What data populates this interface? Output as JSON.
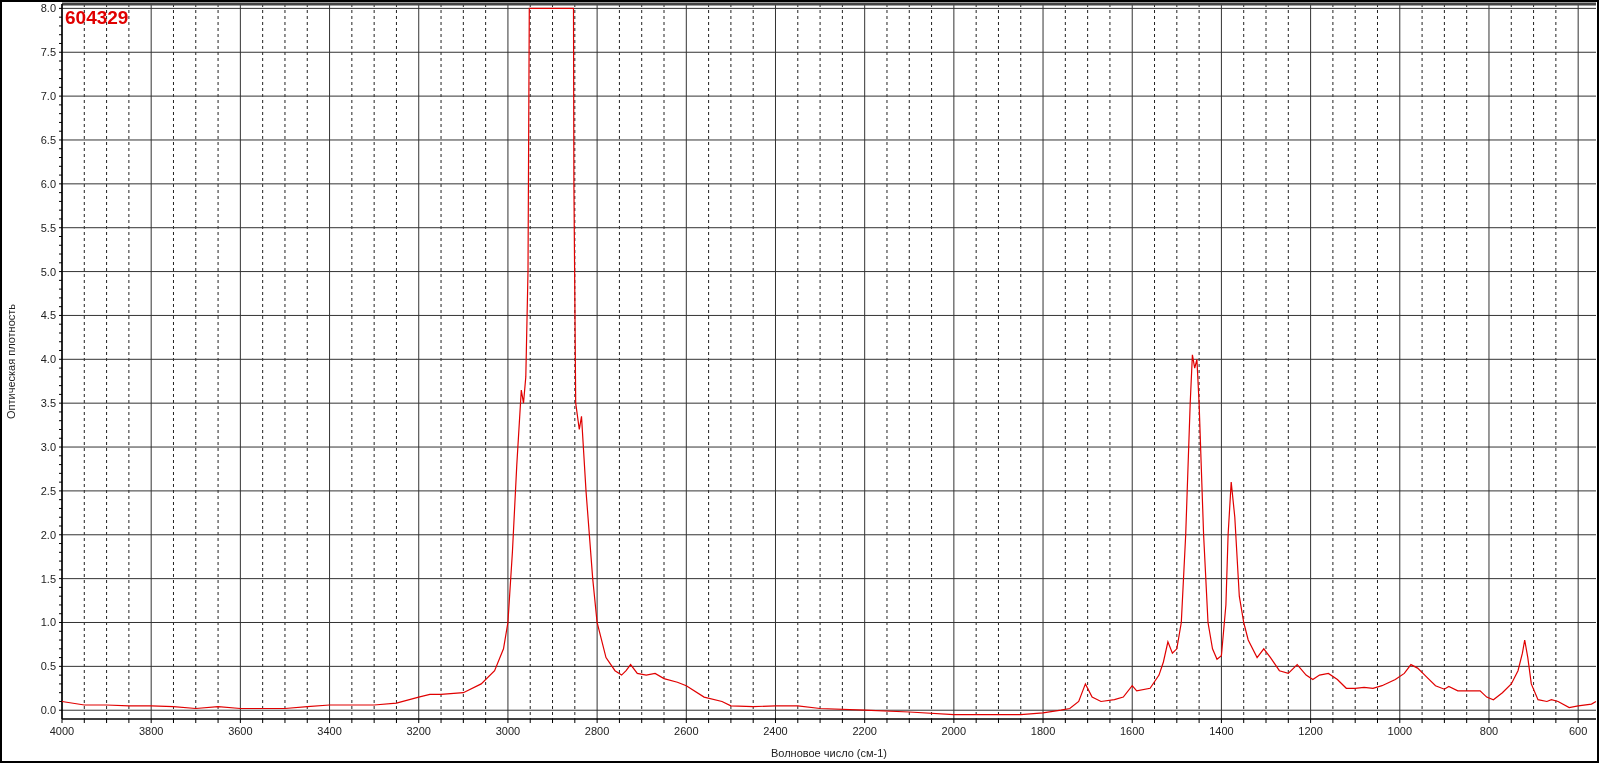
{
  "chart_data": {
    "type": "line",
    "grid": true,
    "title": "604329",
    "xlabel": "Волновое число (см-1)",
    "ylabel": "Оптическая плотность",
    "xlim": [
      4000,
      560
    ],
    "ylim": [
      -0.1,
      8.05
    ],
    "xticks": [
      4000,
      3800,
      3600,
      3400,
      3200,
      3000,
      2800,
      2600,
      2400,
      2200,
      2000,
      1800,
      1600,
      1400,
      1200,
      1000,
      800,
      600
    ],
    "yticks": [
      {
        "value": 0,
        "label": "0.0"
      },
      {
        "value": 0.5,
        "label": "0.5"
      },
      {
        "value": 1,
        "label": "1.0"
      },
      {
        "value": 1.5,
        "label": "1.5"
      },
      {
        "value": 2,
        "label": "2.0"
      },
      {
        "value": 2.5,
        "label": "2.5"
      },
      {
        "value": 3,
        "label": "3.0"
      },
      {
        "value": 3.5,
        "label": "3.5"
      },
      {
        "value": 4,
        "label": "4.0"
      },
      {
        "value": 4.5,
        "label": "4.5"
      },
      {
        "value": 5,
        "label": "5.0"
      },
      {
        "value": 5.5,
        "label": "5.5"
      },
      {
        "value": 6,
        "label": "6.0"
      },
      {
        "value": 6.5,
        "label": "6.5"
      },
      {
        "value": 7,
        "label": "7.0"
      },
      {
        "value": 7.5,
        "label": "7.5"
      },
      {
        "value": 8,
        "label": "8.0"
      }
    ],
    "x": [
      4000,
      3950,
      3900,
      3850,
      3800,
      3750,
      3700,
      3650,
      3600,
      3550,
      3500,
      3450,
      3400,
      3350,
      3300,
      3250,
      3200,
      3175,
      3150,
      3100,
      3060,
      3030,
      3010,
      3000,
      2990,
      2980,
      2970,
      2965,
      2960,
      2955,
      2952,
      2900,
      2853,
      2852,
      2848,
      2840,
      2835,
      2825,
      2810,
      2800,
      2780,
      2760,
      2745,
      2735,
      2725,
      2710,
      2690,
      2670,
      2650,
      2620,
      2600,
      2560,
      2520,
      2500,
      2450,
      2400,
      2350,
      2300,
      2200,
      2100,
      2000,
      1950,
      1850,
      1800,
      1760,
      1740,
      1720,
      1705,
      1690,
      1670,
      1640,
      1620,
      1600,
      1590,
      1560,
      1540,
      1530,
      1520,
      1510,
      1500,
      1490,
      1480,
      1470,
      1465,
      1460,
      1455,
      1450,
      1440,
      1430,
      1420,
      1410,
      1400,
      1390,
      1385,
      1378,
      1370,
      1360,
      1350,
      1340,
      1320,
      1305,
      1290,
      1270,
      1250,
      1230,
      1210,
      1195,
      1180,
      1160,
      1140,
      1120,
      1100,
      1080,
      1060,
      1040,
      1010,
      990,
      975,
      960,
      940,
      920,
      900,
      890,
      870,
      850,
      820,
      805,
      790,
      770,
      750,
      735,
      725,
      720,
      713,
      705,
      690,
      670,
      660,
      645,
      620,
      600,
      570,
      560
    ],
    "series": [
      {
        "color": "#e00000",
        "values": [
          0.1,
          0.06,
          0.06,
          0.05,
          0.05,
          0.04,
          0.02,
          0.04,
          0.02,
          0.02,
          0.02,
          0.04,
          0.06,
          0.06,
          0.06,
          0.08,
          0.15,
          0.18,
          0.18,
          0.2,
          0.3,
          0.45,
          0.7,
          1.0,
          1.8,
          2.8,
          3.65,
          3.5,
          3.8,
          5.0,
          8.0,
          8.0,
          8.0,
          6.0,
          3.5,
          3.2,
          3.35,
          2.5,
          1.5,
          1.0,
          0.6,
          0.45,
          0.4,
          0.45,
          0.52,
          0.42,
          0.4,
          0.42,
          0.36,
          0.32,
          0.28,
          0.15,
          0.1,
          0.05,
          0.04,
          0.05,
          0.05,
          0.02,
          0.0,
          -0.02,
          -0.05,
          -0.05,
          -0.05,
          -0.03,
          0.0,
          0.02,
          0.1,
          0.3,
          0.15,
          0.1,
          0.12,
          0.15,
          0.28,
          0.22,
          0.25,
          0.4,
          0.55,
          0.78,
          0.65,
          0.7,
          1.0,
          2.0,
          3.5,
          4.05,
          3.9,
          4.0,
          3.5,
          2.0,
          1.0,
          0.7,
          0.58,
          0.62,
          1.2,
          2.0,
          2.6,
          2.2,
          1.3,
          1.0,
          0.8,
          0.6,
          0.7,
          0.6,
          0.45,
          0.42,
          0.52,
          0.4,
          0.35,
          0.4,
          0.42,
          0.35,
          0.25,
          0.25,
          0.26,
          0.25,
          0.28,
          0.35,
          0.42,
          0.52,
          0.48,
          0.38,
          0.28,
          0.24,
          0.27,
          0.22,
          0.22,
          0.22,
          0.15,
          0.12,
          0.2,
          0.3,
          0.45,
          0.65,
          0.8,
          0.6,
          0.3,
          0.12,
          0.1,
          0.12,
          0.1,
          0.03,
          0.05,
          0.07,
          0.1
        ]
      }
    ]
  }
}
